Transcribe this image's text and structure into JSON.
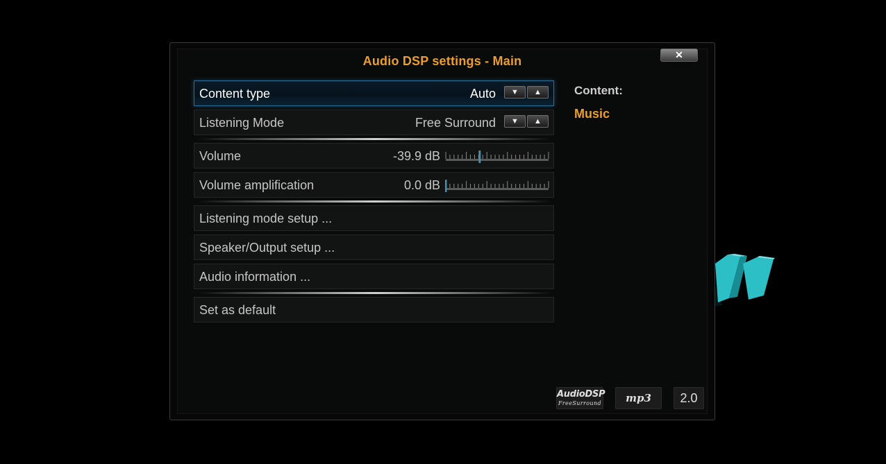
{
  "dialog": {
    "title": "Audio DSP settings - Main",
    "close_glyph": "✕",
    "close_icon": "close-icon"
  },
  "settings": {
    "content_type": {
      "label": "Content type",
      "value": "Auto",
      "down": "▼",
      "up": "▲"
    },
    "listening_mode": {
      "label": "Listening Mode",
      "value": "Free Surround",
      "down": "▼",
      "up": "▲"
    },
    "volume": {
      "label": "Volume",
      "value": "-39.9 dB",
      "level": 0.33
    },
    "volume_amplification": {
      "label": "Volume amplification",
      "value": "0.0 dB",
      "level": 0.0
    },
    "listening_mode_setup": {
      "label": "Listening mode setup ..."
    },
    "speaker_output_setup": {
      "label": "Speaker/Output setup ..."
    },
    "audio_information": {
      "label": "Audio information ..."
    },
    "set_as_default": {
      "label": "Set as default"
    }
  },
  "info": {
    "content_label": "Content:",
    "content_value": "Music"
  },
  "badges": {
    "dsp_main": "AudioDSP",
    "dsp_sub": "FreeSurround",
    "codec": "mp3",
    "channels": "2.0"
  },
  "colors": {
    "accent": "#eb9e2b",
    "focus_border": "#2d6f95",
    "slider_handle": "#4a8fb0",
    "visualizer": "#2fc3c9",
    "background": "#000000"
  }
}
